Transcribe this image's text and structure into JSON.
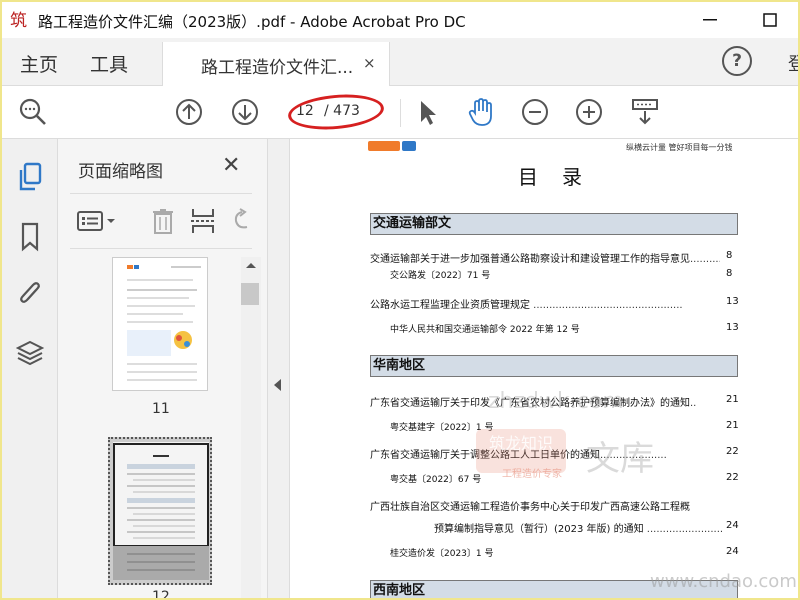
{
  "window": {
    "title": "路工程造价文件汇编（2023版）.pdf - Adobe Acrobat Pro DC",
    "minimize": "—",
    "maximize": "☐"
  },
  "tabs": {
    "home": "主页",
    "tools": "工具",
    "document": "路工程造价文件汇...",
    "close": "×",
    "help": "?",
    "signin": "登"
  },
  "toolbar": {
    "page_current": "12",
    "page_total": "/ 473",
    "annotation_color": "#d62020"
  },
  "sidebar": {
    "title": "页面缩略图",
    "close": "✕",
    "thumbnails": [
      {
        "label": "11"
      },
      {
        "label": "12"
      }
    ]
  },
  "document": {
    "tagline": "纵横云计量 管好项目每一分钱",
    "heading": "目录",
    "sections": [
      {
        "title": "交通运输部文",
        "entries": [
          {
            "text": "交通运输部关于进一步加强普通公路勘察设计和建设管理工作的指导意见",
            "page": "8"
          },
          {
            "text": "交公路发〔2022〕71 号",
            "page": "8",
            "sub": true
          },
          {
            "text": "公路水运工程监理企业资质管理规定",
            "page": "13"
          },
          {
            "text": "中华人民共和国交通运输部令 2022 年第 12 号",
            "page": "13",
            "sub": true
          }
        ]
      },
      {
        "title": "华南地区",
        "entries": [
          {
            "text": "广东省交通运输厅关于印发《广东省农村公路养护预算编制办法》的通知",
            "page": "21"
          },
          {
            "text": "粤交基建字〔2022〕1 号",
            "page": "21",
            "sub": true
          },
          {
            "text": "广东省交通运输厅关于调整公路工人工日单价的通知",
            "page": "22"
          },
          {
            "text": "粤交基〔2022〕67 号",
            "page": "22",
            "sub": true
          },
          {
            "text": "广西壮族自治区交通运输工程造价事务中心关于印发广西高速公路工程概",
            "page": ""
          },
          {
            "text": "预算编制指导意见（暂行）(2023 年版) 的通知",
            "page": "24"
          },
          {
            "text": "桂交造价发〔2023〕1 号",
            "page": "24",
            "sub": true
          }
        ]
      },
      {
        "title": "西南地区",
        "entries": []
      }
    ],
    "watermarks": [
      "zhzdwk.com",
      "筑龙知识",
      "文库",
      "工程造价专家",
      "www.cndao.com"
    ]
  }
}
